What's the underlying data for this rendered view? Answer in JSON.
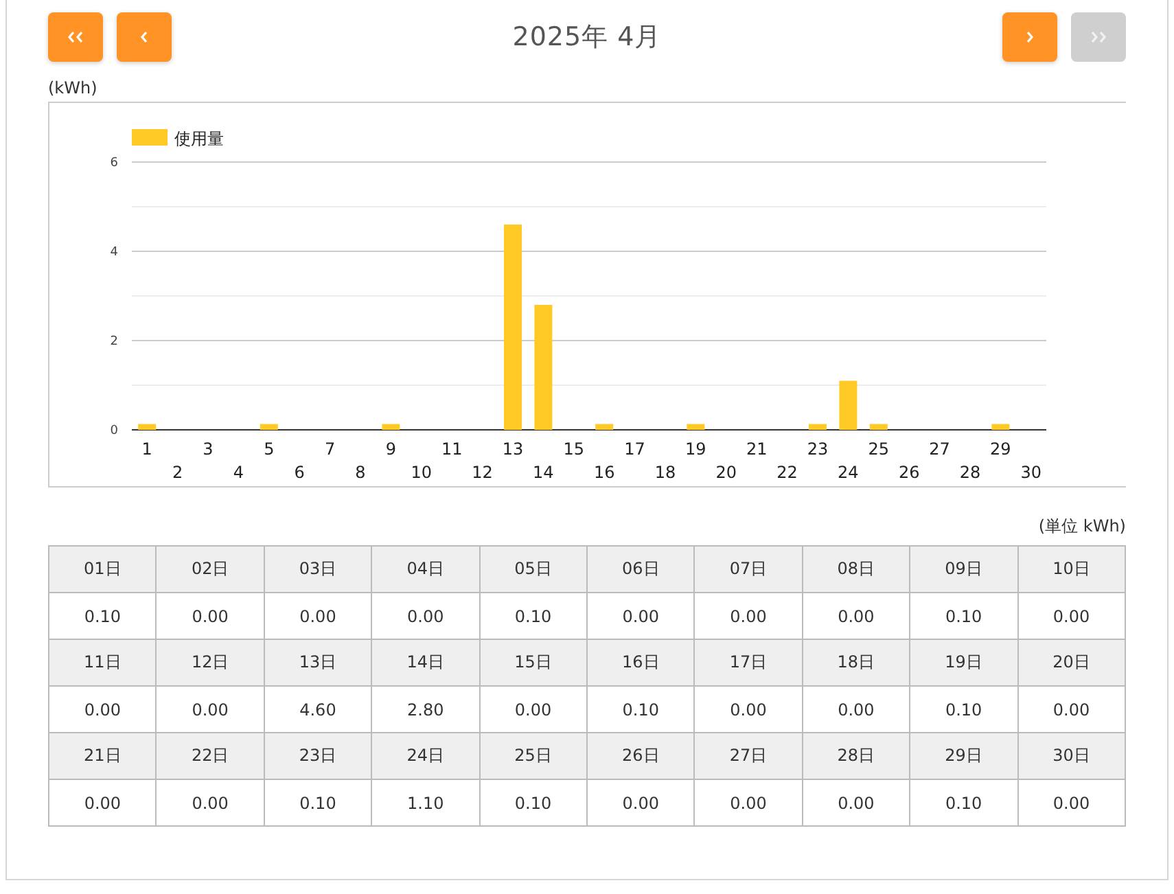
{
  "nav_buttons": [
    {
      "kind": "first",
      "disabled": false
    },
    {
      "kind": "prev",
      "disabled": false
    },
    {
      "kind": "next",
      "disabled": false
    },
    {
      "kind": "last",
      "disabled": true
    }
  ],
  "title": "2025年 4月",
  "chart_unit": "(kWh)",
  "chart": {
    "chart_data": {
      "type": "bar",
      "series": [
        {
          "name": "使用量",
          "color": "#ffc926",
          "values": [
            0.1,
            0,
            0,
            0,
            0.1,
            0,
            0,
            0,
            0.1,
            0,
            0,
            0,
            4.6,
            2.8,
            0,
            0.1,
            0,
            0,
            0.1,
            0,
            0,
            0,
            0.1,
            1.1,
            0.1,
            0,
            0,
            0,
            0.1,
            0
          ]
        }
      ],
      "categories": [
        "1",
        "2",
        "3",
        "4",
        "5",
        "6",
        "7",
        "8",
        "9",
        "10",
        "11",
        "12",
        "13",
        "14",
        "15",
        "16",
        "17",
        "18",
        "19",
        "20",
        "21",
        "22",
        "23",
        "24",
        "25",
        "26",
        "27",
        "28",
        "29",
        "30"
      ],
      "ylim": [
        0,
        6
      ],
      "yticks": [
        0,
        2,
        4,
        6
      ]
    }
  },
  "table_unit": "(単位 kWh)",
  "table": {
    "rows": [
      {
        "kind": "header",
        "cells": [
          "01日",
          "02日",
          "03日",
          "04日",
          "05日",
          "06日",
          "07日",
          "08日",
          "09日",
          "10日"
        ]
      },
      {
        "kind": "value",
        "cells": [
          "0.10",
          "0.00",
          "0.00",
          "0.00",
          "0.10",
          "0.00",
          "0.00",
          "0.00",
          "0.10",
          "0.00"
        ]
      },
      {
        "kind": "header",
        "cells": [
          "11日",
          "12日",
          "13日",
          "14日",
          "15日",
          "16日",
          "17日",
          "18日",
          "19日",
          "20日"
        ]
      },
      {
        "kind": "value",
        "cells": [
          "0.00",
          "0.00",
          "4.60",
          "2.80",
          "0.00",
          "0.10",
          "0.00",
          "0.00",
          "0.10",
          "0.00"
        ]
      },
      {
        "kind": "header",
        "cells": [
          "21日",
          "22日",
          "23日",
          "24日",
          "25日",
          "26日",
          "27日",
          "28日",
          "29日",
          "30日"
        ]
      },
      {
        "kind": "value",
        "cells": [
          "0.00",
          "0.00",
          "0.10",
          "1.10",
          "0.10",
          "0.00",
          "0.00",
          "0.00",
          "0.10",
          "0.00"
        ]
      }
    ]
  }
}
